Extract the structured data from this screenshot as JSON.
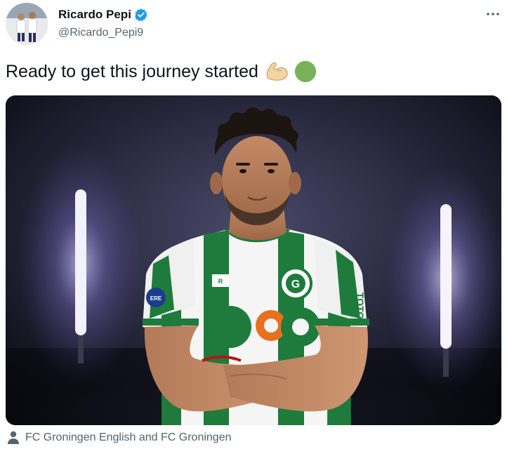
{
  "author": {
    "display_name": "Ricardo Pepi",
    "handle": "@Ricardo_Pepi9",
    "verified": true
  },
  "tweet": {
    "text": "Ready to get this journey started",
    "emojis": [
      "flexed-biceps-emoji",
      "green-circle-emoji"
    ]
  },
  "media": {
    "shirt_text": "TOTO"
  },
  "tagged": {
    "text": "FC Groningen English and FC Groningen"
  },
  "colors": {
    "verified_blue": "#1d9bf0",
    "muted_text": "#536471",
    "jersey_green": "#1e7b3c"
  }
}
